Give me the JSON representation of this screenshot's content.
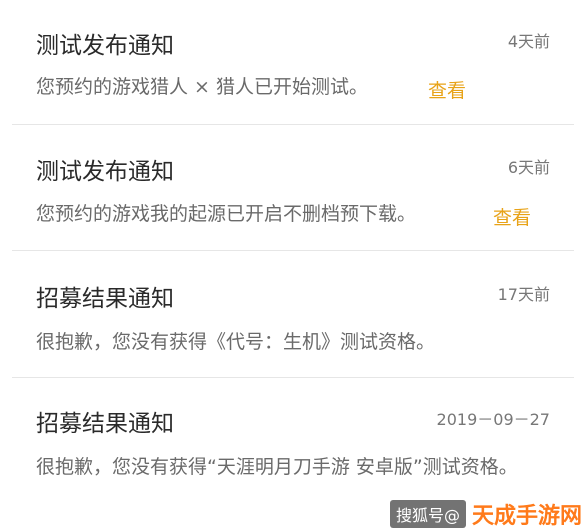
{
  "notifications": [
    {
      "title": "测试发布通知",
      "time": "4天前",
      "desc": "您预约的游戏猎人 × 猎人已开始测试。",
      "action": "查看"
    },
    {
      "title": "测试发布通知",
      "time": "6天前",
      "desc": "您预约的游戏我的起源已开启不删档预下载。",
      "action": "查看"
    },
    {
      "title": "招募结果通知",
      "time": "17天前",
      "desc": "很抱歉，您没有获得《代号：生机》测试资格。"
    },
    {
      "title": "招募结果通知",
      "time": "2019－09－27",
      "desc": "很抱歉，您没有获得“天涯明月刀手游 安卓版”测试资格。"
    }
  ],
  "watermark": {
    "source": "搜狐号@",
    "brand": "天成手游网"
  },
  "colors": {
    "title": "#2a2a2a",
    "time": "#777777",
    "desc": "#6a6a6a",
    "action": "#e8a318",
    "divider": "#e6e6e6",
    "watermark_brand": "#ff7a1a"
  }
}
